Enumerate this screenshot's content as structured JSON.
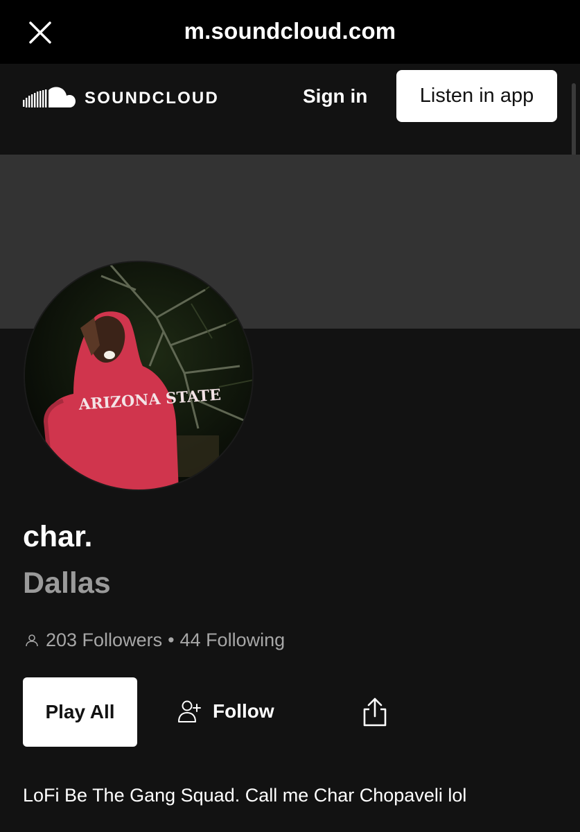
{
  "browser": {
    "url": "m.soundcloud.com",
    "close_icon": "close-icon"
  },
  "header": {
    "logo_text": "SOUNDCLOUD",
    "sign_in": "Sign in",
    "listen_in_app": "Listen in app"
  },
  "profile": {
    "name": "char.",
    "city": "Dallas",
    "followers": "203 Followers",
    "separator": "•",
    "following": "44 Following",
    "bio": "LoFi Be The Gang Squad. Call me Char Chopaveli lol",
    "avatar_hoodie_text": "ARIZONA STATE"
  },
  "actions": {
    "play_all": "Play All",
    "follow": "Follow"
  },
  "colors": {
    "background": "#121212",
    "banner": "#333333",
    "browser_bar": "#000000",
    "secondary_text": "#9a9a9a"
  }
}
